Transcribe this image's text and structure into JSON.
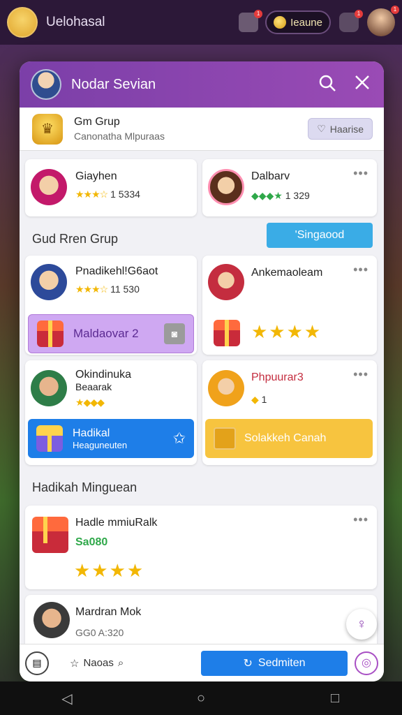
{
  "app": {
    "title": "Uelohasal",
    "coins_label": "Ieaune"
  },
  "panel": {
    "title": "Nodar Sevian",
    "group": {
      "name": "Gm Grup",
      "subtitle": "Canonatha Mlpuraas",
      "leave_label": "Haarise"
    },
    "members_top": [
      {
        "name": "Giayhen",
        "rating": "★★★☆",
        "score": "1 5334"
      },
      {
        "name": "Dalbarv",
        "rating": "◆◆◆★",
        "score": "1 329"
      }
    ],
    "section1": {
      "title": "Gud Rren Grup",
      "button": "'Singaood"
    },
    "members_mid": [
      {
        "name": "Pnadikehl!G6aot",
        "rating": "★★★☆",
        "score": "11 530",
        "feature": "Maldaovar 2"
      },
      {
        "name": "Ankemaoleam",
        "rating": "★★★★"
      }
    ],
    "members_low": [
      {
        "name": "Okindinuka",
        "name2": "Beaarak",
        "rating": "★◆◆◆",
        "feature_title": "Hadikal",
        "feature_sub": "Heaguneuten"
      },
      {
        "name": "Phpuurar3",
        "rating": "◆",
        "score": "1",
        "feature": "Solakkeh Canah"
      }
    ],
    "section2": {
      "title": "Hadikah Minguean"
    },
    "weekly": [
      {
        "name": "Hadle mmiuRalk",
        "value": "Sa080",
        "rating": "★★★★"
      },
      {
        "name": "Mardran Mok",
        "value": "GG0 A:320"
      }
    ],
    "bottom": {
      "nav_label": "Naoas",
      "send_label": "Sedmiten"
    }
  },
  "colors": {
    "header": "#8a45ae",
    "accent_blue": "#1e7ee8",
    "feature_purple": "#c9a3ef",
    "feature_yellow": "#f7c43f",
    "star": "#f2b705"
  }
}
